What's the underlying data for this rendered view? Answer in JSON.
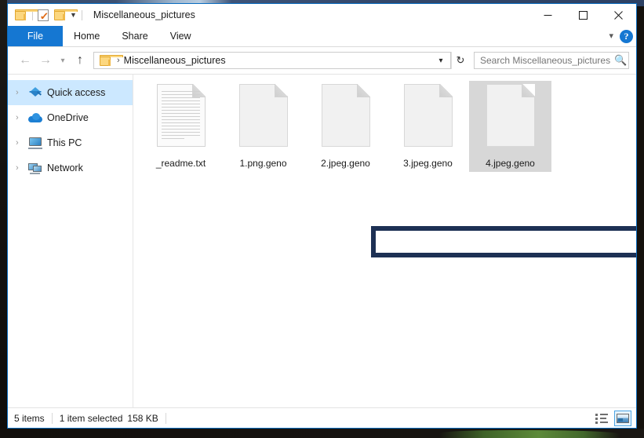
{
  "window": {
    "title": "Miscellaneous_pictures",
    "quick_access_toolbar": [
      {
        "name": "folder-icon",
        "label": "Folder"
      },
      {
        "name": "properties-icon",
        "label": "Properties"
      },
      {
        "name": "new-folder-icon",
        "label": "New folder"
      },
      {
        "name": "customize-chevron-icon",
        "label": "Customize Quick Access Toolbar"
      }
    ],
    "controls": {
      "minimize": "Minimize",
      "maximize": "Maximize",
      "close": "Close"
    }
  },
  "ribbon": {
    "tabs": [
      {
        "label": "File",
        "active": true
      },
      {
        "label": "Home",
        "active": false
      },
      {
        "label": "Share",
        "active": false
      },
      {
        "label": "View",
        "active": false
      }
    ],
    "expand_label": "Expand the Ribbon",
    "help_label": "?"
  },
  "address_bar": {
    "back_label": "Back",
    "forward_label": "Forward",
    "recent_label": "Recent locations",
    "up_label": "Up",
    "breadcrumb_root_icon": "folder-icon",
    "breadcrumb_separator": "›",
    "path": "Miscellaneous_pictures",
    "dropdown_label": "Previous locations",
    "refresh_label": "Refresh",
    "search_placeholder": "Search Miscellaneous_pictures",
    "search_value": ""
  },
  "navigation_pane": {
    "items": [
      {
        "label": "Quick access",
        "icon": "pin-star-icon",
        "selected": true
      },
      {
        "label": "OneDrive",
        "icon": "cloud-icon",
        "selected": false
      },
      {
        "label": "This PC",
        "icon": "computer-icon",
        "selected": false
      },
      {
        "label": "Network",
        "icon": "network-icon",
        "selected": false
      }
    ],
    "expander_glyph": "›"
  },
  "files": [
    {
      "name": "_readme.txt",
      "icon": "text-document-icon",
      "selected": false
    },
    {
      "name": "1.png.geno",
      "icon": "blank-document-icon",
      "selected": false
    },
    {
      "name": "2.jpeg.geno",
      "icon": "blank-document-icon",
      "selected": false
    },
    {
      "name": "3.jpeg.geno",
      "icon": "blank-document-icon",
      "selected": false
    },
    {
      "name": "4.jpeg.geno",
      "icon": "blank-document-icon",
      "selected": true
    }
  ],
  "annotation": {
    "color": "#1d3054",
    "label": "highlight-rectangle"
  },
  "status_bar": {
    "item_count": "5 items",
    "selection": "1 item selected",
    "size": "158 KB",
    "details_view_label": "Details view",
    "large_icons_view_label": "Large icons view"
  }
}
